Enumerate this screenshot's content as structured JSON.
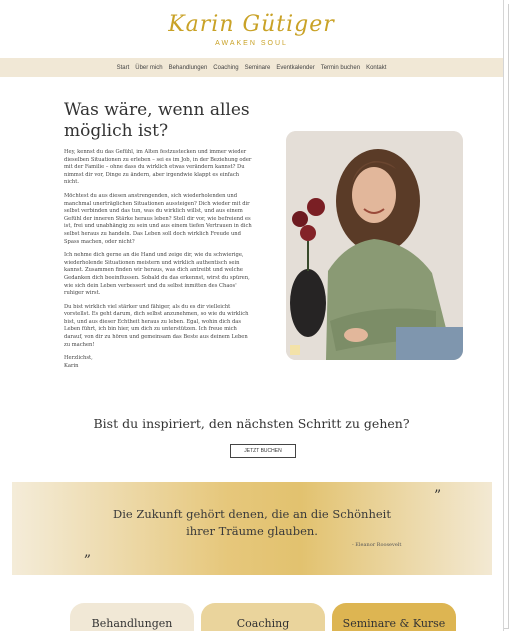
{
  "header": {
    "logo_script": "Karin Gütiger",
    "logo_sub": "AWAKEN SOUL"
  },
  "nav": {
    "items": [
      "Start",
      "Über mich",
      "Behandlungen",
      "Coaching",
      "Seminare",
      "Eventkalender",
      "Termin buchen",
      "Kontakt"
    ]
  },
  "main": {
    "headline": "Was wäre, wenn alles möglich ist?",
    "paragraphs": [
      "Hey, kennst du das Gefühl, im Alten festzustecken und immer wieder dieselben Situationen zu erleben – sei es im Job, in der Beziehung oder mit der Familie – ohne dass du wirklich etwas verändern kannst? Du nimmst dir vor, Dinge zu ändern, aber irgendwie klappt es einfach nicht.",
      "Möchtest du aus diesen anstrengenden, sich wiederholenden und manchmal unerträglichen Situationen aussteigen? Dich wieder mit dir selbst verbinden und das tun, was du wirklich willst, und aus einem Gefühl der inneren Stärke heraus leben? Stell dir vor, wie befreiend es ist, frei und unabhängig zu sein und aus einem tiefen Vertrauen in dich selbst heraus zu handeln. Das Leben soll doch wirklich Freude und Spass machen, oder nicht?",
      "Ich nehme dich gerne an die Hand und zeige dir, wie du schwierige, wiederholende Situationen meistern und wirklich authentisch sein kannst. Zusammen finden wir heraus, was dich antreibt und welche Gedanken dich beeinflussen. Sobald du das erkennst, wirst du spüren, wie sich dein Leben verbessert und du selbst inmitten des Chaos' ruhiger wirst.",
      "Du bist wirklich viel stärker und fähiger, als du es dir vielleicht vorstellst. Es geht darum, dich selbst anzunehmen, so wie du wirklich bist, und aus dieser Echtheit heraus zu leben. Egal, wohin dich das Leben führt, ich bin hier, um dich zu unterstützen. Ich freue mich darauf, von dir zu hören und gemeinsam das Beste aus deinem Leben zu machen!",
      "Herzlichst,\nKarin"
    ]
  },
  "cta": {
    "title": "Bist du inspiriert, den nächsten Schritt zu gehen?",
    "button_label": "JETZT BUCHEN"
  },
  "quote": {
    "text": "Die Zukunft gehört denen, die an die Schönheit ihrer Träume glauben.",
    "author": "- Eleanor Roosevelt",
    "open_mark": "”",
    "close_mark": "„"
  },
  "tiles": [
    "Behandlungen",
    "Coaching",
    "Seminare & Kurse"
  ],
  "colors": {
    "accent_gold": "#c9a227",
    "nav_bg": "#f1e8d6"
  }
}
